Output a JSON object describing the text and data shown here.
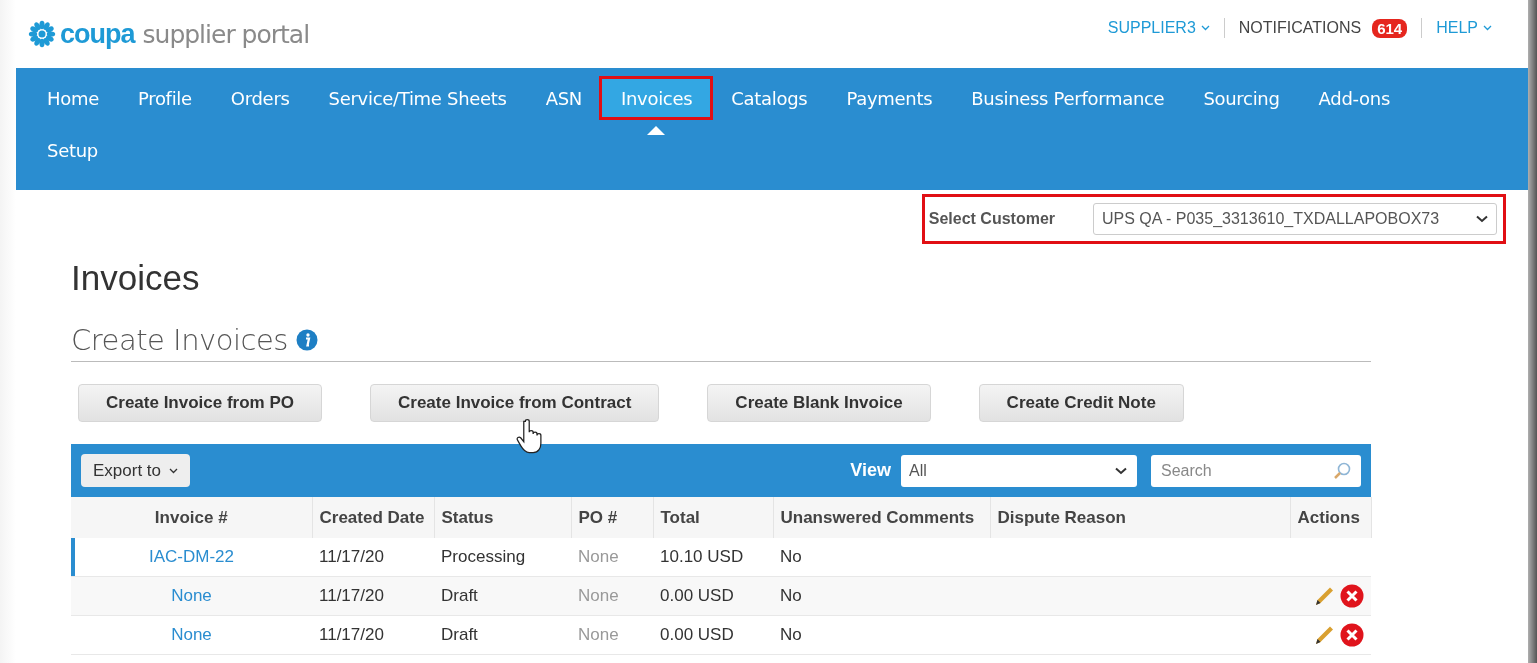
{
  "header": {
    "logo": {
      "brand": "coupa",
      "product": "supplier portal"
    },
    "user_menu": "SUPPLIER3",
    "notifications": {
      "label": "NOTIFICATIONS",
      "count": "614"
    },
    "help_menu": "HELP"
  },
  "nav": [
    {
      "label": "Home",
      "selected": false,
      "highlighted": false
    },
    {
      "label": "Profile",
      "selected": false,
      "highlighted": false
    },
    {
      "label": "Orders",
      "selected": false,
      "highlighted": false
    },
    {
      "label": "Service/Time Sheets",
      "selected": false,
      "highlighted": false
    },
    {
      "label": "ASN",
      "selected": false,
      "highlighted": false
    },
    {
      "label": "Invoices",
      "selected": true,
      "highlighted": true
    },
    {
      "label": "Catalogs",
      "selected": false,
      "highlighted": false
    },
    {
      "label": "Payments",
      "selected": false,
      "highlighted": false
    },
    {
      "label": "Business Performance",
      "selected": false,
      "highlighted": false
    },
    {
      "label": "Sourcing",
      "selected": false,
      "highlighted": false
    },
    {
      "label": "Add-ons",
      "selected": false,
      "highlighted": false
    },
    {
      "label": "Setup",
      "selected": false,
      "highlighted": false
    }
  ],
  "customer_select": {
    "label": "Select Customer",
    "value": "UPS QA - P035_3313610_TXDALLAPOBOX73",
    "highlighted": true
  },
  "page_title": "Invoices",
  "section": {
    "title": "Create Invoices"
  },
  "actions": [
    "Create Invoice from PO",
    "Create Invoice from Contract",
    "Create Blank Invoice",
    "Create Credit Note"
  ],
  "table": {
    "export_button": "Export to",
    "view_label": "View",
    "view_value": "All",
    "search_placeholder": "Search",
    "columns": [
      "Invoice #",
      "Created Date",
      "Status",
      "PO #",
      "Total",
      "Unanswered Comments",
      "Dispute Reason",
      "Actions"
    ],
    "rows": [
      {
        "invoice": "IAC-DM-22",
        "created": "11/17/20",
        "status": "Processing",
        "po": "None",
        "total": "10.10 USD",
        "comments": "No",
        "editable": false,
        "selected": true
      },
      {
        "invoice": "None",
        "created": "11/17/20",
        "status": "Draft",
        "po": "None",
        "total": "0.00 USD",
        "comments": "No",
        "editable": true,
        "selected": false
      },
      {
        "invoice": "None",
        "created": "11/17/20",
        "status": "Draft",
        "po": "None",
        "total": "0.00 USD",
        "comments": "No",
        "editable": true,
        "selected": false
      }
    ]
  }
}
